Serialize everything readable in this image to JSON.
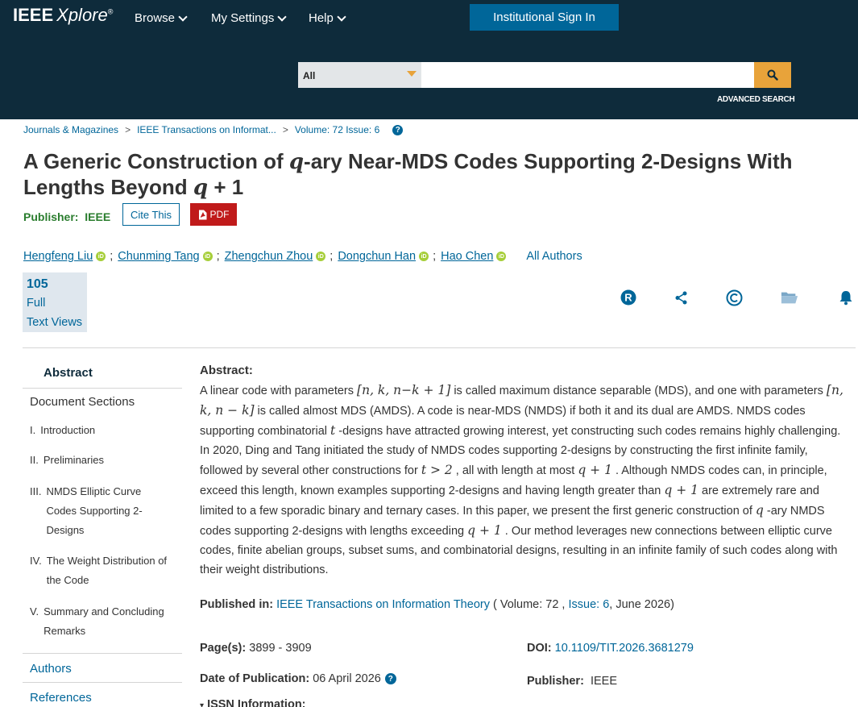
{
  "header": {
    "logo_main": "IEEE",
    "logo_sub": "Xplore",
    "logo_mark": "®",
    "nav": [
      {
        "label": "Browse"
      },
      {
        "label": "My Settings"
      },
      {
        "label": "Help"
      }
    ],
    "signin_label": "Institutional Sign In",
    "search": {
      "scope": "All",
      "query": "",
      "advanced_label": "ADVANCED SEARCH"
    }
  },
  "breadcrumb": {
    "items": [
      "Journals & Magazines",
      "IEEE Transactions on Informat...",
      "Volume: 72 Issue: 6"
    ],
    "separator": ">"
  },
  "article": {
    "title_part1": "A Generic Construction of ",
    "title_q": "q",
    "title_part2": "-ary Near-MDS Codes Supporting 2-Designs With Lengths Beyond ",
    "title_q2": "q",
    "title_part3": " + 1",
    "publisher_label": "Publisher:",
    "publisher_value": "IEEE",
    "cite_label": "Cite This",
    "pdf_label": "PDF",
    "authors": [
      {
        "name": "Hengfeng Liu"
      },
      {
        "name": "Chunming Tang"
      },
      {
        "name": "Zhengchun Zhou"
      },
      {
        "name": "Dongchun Han"
      },
      {
        "name": "Hao Chen"
      }
    ],
    "author_separator": ";",
    "orcid_mark": "iD",
    "all_authors_label": "All Authors",
    "metrics": {
      "count": "105",
      "line1": "Full",
      "line2": "Text Views"
    }
  },
  "toolbar": {
    "icons": [
      "rights-icon",
      "share-icon",
      "copyright-icon",
      "folder-icon",
      "alert-bell-icon"
    ]
  },
  "leftnav": {
    "abstract_label": "Abstract",
    "sections_heading": "Document Sections",
    "sections": [
      {
        "num": "I.",
        "title": "Introduction"
      },
      {
        "num": "II.",
        "title": "Preliminaries"
      },
      {
        "num": "III.",
        "title": "NMDS Elliptic Curve Codes Supporting 2-Designs"
      },
      {
        "num": "IV.",
        "title": "The Weight Distribution of the Code"
      },
      {
        "num": "V.",
        "title": "Summary and Concluding Remarks"
      }
    ],
    "links": [
      "Authors",
      "References"
    ]
  },
  "abstract": {
    "heading": "Abstract:",
    "t1": "A linear code with parameters ",
    "m1": "[n, k, n−k + 1]",
    "t2": " is called maximum distance separable (MDS), and one with parameters ",
    "m2": "[n, k, n − k]",
    "t3": " is called almost MDS (AMDS). A code is near-MDS (NMDS) if both it and its dual are AMDS. NMDS codes supporting combinatorial ",
    "m3": "t",
    "t4": " -designs have attracted growing interest, yet constructing such codes remains highly challenging. In 2020, Ding and Tang initiated the study of NMDS codes supporting 2-designs by constructing the first infinite family, followed by several other constructions for ",
    "m4": "t > 2",
    "t5": " , all with length at most ",
    "m5": "q + 1",
    "t6": " . Although NMDS codes can, in principle, exceed this length, known examples supporting 2-designs and having length greater than ",
    "m6": "q + 1",
    "t7": " are extremely rare and limited to a few sporadic binary and ternary cases. In this paper, we present the first generic construction of ",
    "m7": "q",
    "t8": " -ary NMDS codes supporting 2-designs with lengths exceeding ",
    "m8": "q + 1",
    "t9": " . Our method leverages new connections between elliptic curve codes, finite abelian groups, subset sums, and combinatorial designs, resulting in an infinite family of such codes along with their weight distributions."
  },
  "publication": {
    "published_in_label": "Published in:",
    "journal": "IEEE Transactions on Information Theory",
    "vol_prefix": " ( Volume: 72 , ",
    "issue": "Issue: 6",
    "date_suffix": ", June 2026)",
    "pages_label": "Page(s):",
    "pages": "3899 - 3909",
    "doi_label": "DOI:",
    "doi": "10.1109/TIT.2026.3681279",
    "pubdate_label": "Date of Publication:",
    "pubdate": "06 April 2026",
    "publisher_label": "Publisher:",
    "publisher": "IEEE",
    "issn_label": "ISSN Information:"
  },
  "colors": {
    "header_bg": "#0e2b3b",
    "accent_blue": "#006699",
    "search_orange": "#e8a33a",
    "pdf_red": "#c01a1a",
    "publisher_green": "#2a7d2e",
    "orcid_green": "#a6ce39"
  }
}
